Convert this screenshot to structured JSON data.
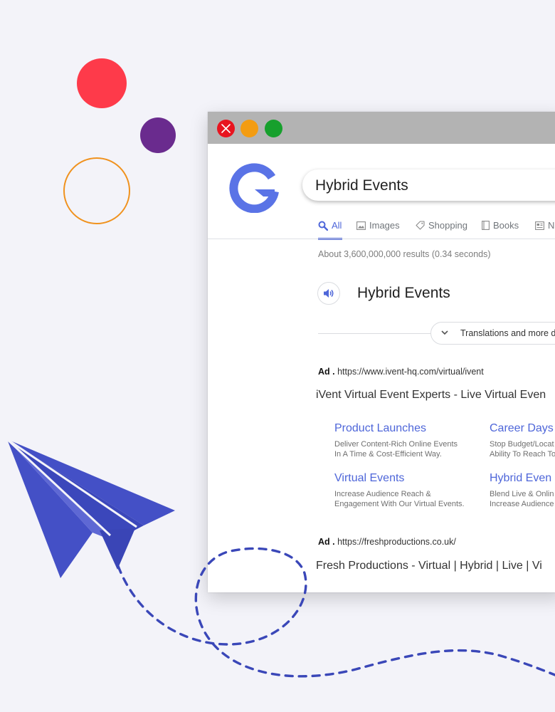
{
  "colors": {
    "background": "#f3f3f9",
    "accent_blue": "#4e66d9",
    "plane_blue": "#4450c6",
    "dot_red": "#fe3a4a",
    "dot_purple": "#6a2b8e",
    "ring_orange": "#f0921e",
    "traffic_red": "#e8141f",
    "traffic_orange": "#f39c12",
    "traffic_green": "#17a02d",
    "titlebar": "#b3b3b3"
  },
  "window": {
    "controls": [
      "close-icon",
      "minimize-dot",
      "maximize-dot"
    ]
  },
  "search": {
    "logo_icon": "g-logo-icon",
    "query": "Hybrid Events"
  },
  "tabs": [
    {
      "label": "All",
      "icon": "search-icon",
      "active": true
    },
    {
      "label": "Images",
      "icon": "image-icon",
      "active": false
    },
    {
      "label": "Shopping",
      "icon": "tag-icon",
      "active": false
    },
    {
      "label": "Books",
      "icon": "book-icon",
      "active": false
    },
    {
      "label": "N",
      "icon": "news-icon",
      "active": false
    }
  ],
  "results": {
    "stats": "About 3,600,000,000 results (0.34 seconds)",
    "dictionary": {
      "speaker_icon": "speaker-icon",
      "word": "Hybrid Events",
      "translations_label": "Translations and more d"
    },
    "ads": [
      {
        "prefix": "Ad .",
        "url": "https://www.ivent-hq.com/virtual/ivent",
        "title": "iVent Virtual Event Experts - Live Virtual Even",
        "sitelinks": [
          {
            "title": "Product Launches",
            "desc": "Deliver Content-Rich Online Events\nIn A Time & Cost-Efficient Way."
          },
          {
            "title": "Career Days",
            "desc": "Stop Budget/Locat\nAbility To Reach To"
          },
          {
            "title": "Virtual Events",
            "desc": "Increase Audience Reach &\nEngagement With Our Virtual Events."
          },
          {
            "title": "Hybrid Even",
            "desc": "Blend Live & Onlin\nIncrease Audience"
          }
        ]
      },
      {
        "prefix": "Ad .",
        "url": "https://freshproductions.co.uk/",
        "title": "Fresh Productions - Virtual | Hybrid | Live | Vi"
      }
    ]
  },
  "decorations": [
    "red-dot",
    "purple-dot",
    "orange-ring",
    "paper-plane-icon",
    "dashed-flight-path"
  ]
}
